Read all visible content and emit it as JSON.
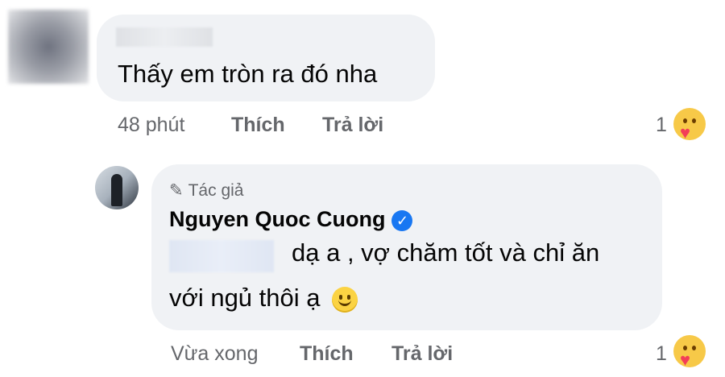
{
  "comment1": {
    "text": "Thấy em tròn ra đó nha",
    "time": "48 phút",
    "like_label": "Thích",
    "reply_label": "Trả lời",
    "reaction_count": "1",
    "reaction_icon": "care-reaction-icon"
  },
  "comment2": {
    "author_badge": "Tác giả",
    "author_name": "Nguyen Quoc Cuong",
    "text_line1": "dạ a , vợ chăm tốt và chỉ ăn",
    "text_line2": "với ngủ thôi ạ",
    "time": "Vừa xong",
    "like_label": "Thích",
    "reply_label": "Trả lời",
    "reaction_count": "1",
    "reaction_icon": "care-reaction-icon"
  },
  "colors": {
    "bubble_bg": "#f0f2f5",
    "meta_text": "#65676b",
    "verified_blue": "#1877f2"
  }
}
